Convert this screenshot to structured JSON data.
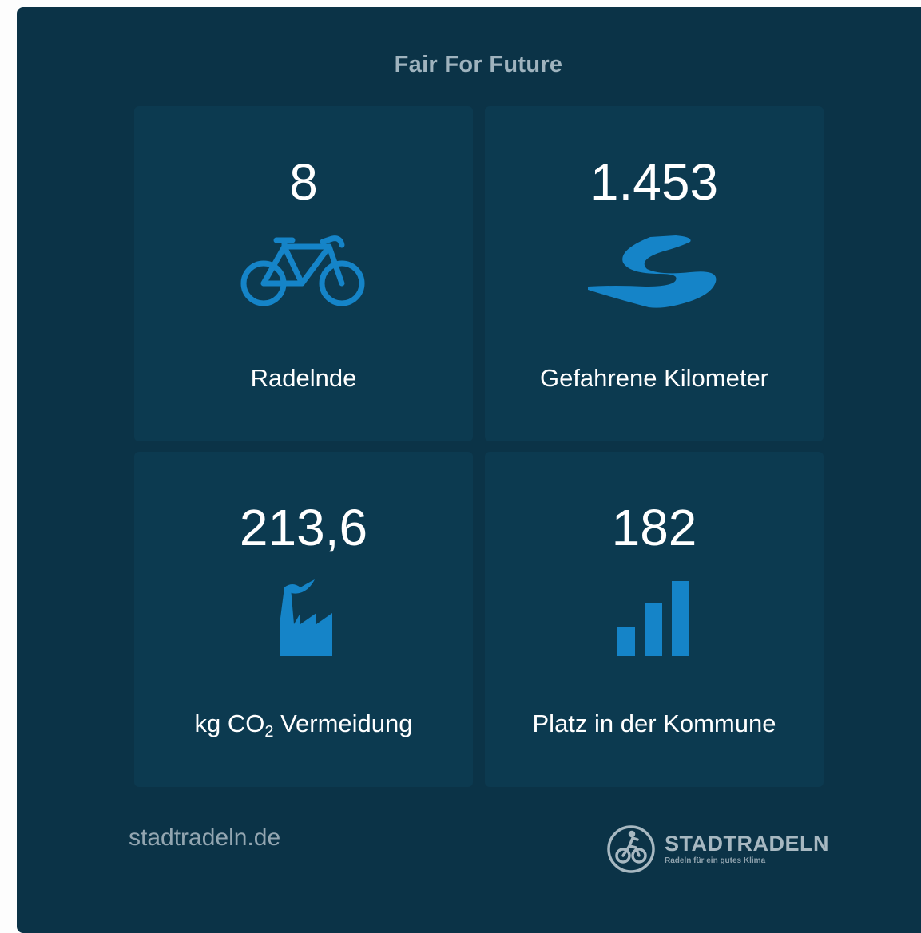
{
  "widget": {
    "title": "Fair For Future",
    "accent_color": "#1584c8",
    "tiles": [
      {
        "value": "8",
        "label": "Radelnde",
        "icon": "bicycle-icon"
      },
      {
        "value": "1.453",
        "label": "Gefahrene Kilometer",
        "icon": "road-icon"
      },
      {
        "value": "213,6",
        "label_prefix": "kg CO",
        "label_sub": "2",
        "label_suffix": " Vermeidung",
        "icon": "factory-icon"
      },
      {
        "value": "182",
        "label": "Platz in der Kommune",
        "icon": "ranking-bars-icon"
      }
    ],
    "footer": {
      "link_text": "stadtradeln.de",
      "logo_name": "STADTRADELN",
      "logo_tagline": "Radeln für ein gutes Klima"
    }
  }
}
